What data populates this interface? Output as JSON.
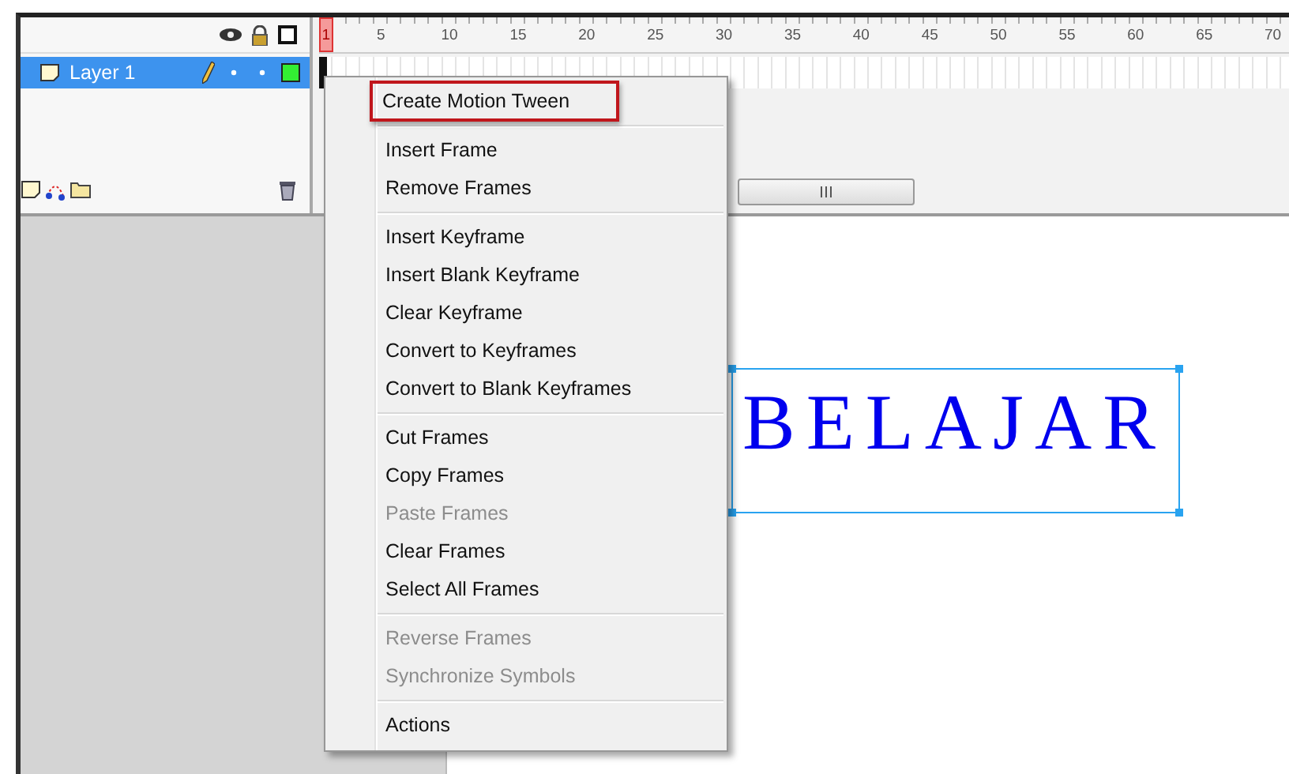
{
  "timeline": {
    "ruler": [
      {
        "label": "1"
      },
      {
        "label": "5"
      },
      {
        "label": "10"
      },
      {
        "label": "15"
      },
      {
        "label": "20"
      },
      {
        "label": "25"
      },
      {
        "label": "30"
      },
      {
        "label": "35"
      },
      {
        "label": "40"
      },
      {
        "label": "45"
      },
      {
        "label": "50"
      },
      {
        "label": "55"
      },
      {
        "label": "60"
      },
      {
        "label": "65"
      },
      {
        "label": "70"
      }
    ],
    "layers": [
      {
        "name": "Layer 1",
        "selected": true,
        "color": "#33ee33"
      }
    ]
  },
  "context_menu": {
    "sections": [
      {
        "items": [
          {
            "label": "Create Motion Tween",
            "disabled": false,
            "highlighted": true
          }
        ]
      },
      {
        "items": [
          {
            "label": "Insert Frame",
            "disabled": false,
            "highlighted": false
          },
          {
            "label": "Remove Frames",
            "disabled": false,
            "highlighted": false
          }
        ]
      },
      {
        "items": [
          {
            "label": "Insert Keyframe",
            "disabled": false,
            "highlighted": false
          },
          {
            "label": "Insert Blank Keyframe",
            "disabled": false,
            "highlighted": false
          },
          {
            "label": "Clear Keyframe",
            "disabled": false,
            "highlighted": false
          },
          {
            "label": "Convert to Keyframes",
            "disabled": false,
            "highlighted": false
          },
          {
            "label": "Convert to Blank Keyframes",
            "disabled": false,
            "highlighted": false
          }
        ]
      },
      {
        "items": [
          {
            "label": "Cut Frames",
            "disabled": false,
            "highlighted": false
          },
          {
            "label": "Copy Frames",
            "disabled": false,
            "highlighted": false
          },
          {
            "label": "Paste Frames",
            "disabled": true,
            "highlighted": false
          },
          {
            "label": "Clear Frames",
            "disabled": false,
            "highlighted": false
          },
          {
            "label": "Select All Frames",
            "disabled": false,
            "highlighted": false
          }
        ]
      },
      {
        "items": [
          {
            "label": "Reverse Frames",
            "disabled": true,
            "highlighted": false
          },
          {
            "label": "Synchronize Symbols",
            "disabled": true,
            "highlighted": false
          }
        ]
      },
      {
        "items": [
          {
            "label": "Actions",
            "disabled": false,
            "highlighted": false
          }
        ]
      }
    ]
  },
  "stage": {
    "text": "BELAJAR",
    "selected": true
  }
}
